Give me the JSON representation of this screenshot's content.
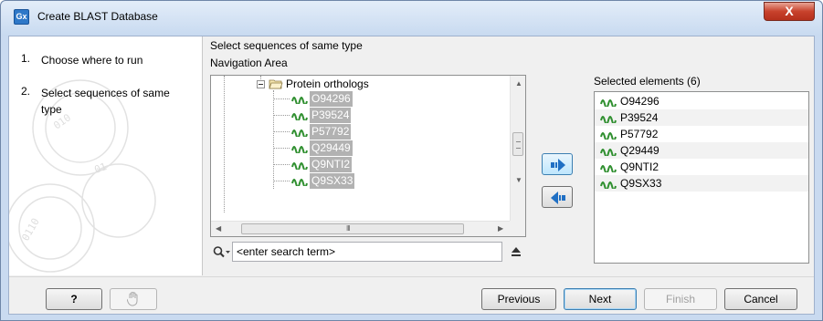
{
  "window": {
    "app_icon": "Gx",
    "title": "Create BLAST Database",
    "close_glyph": "X"
  },
  "steps": [
    {
      "num": "1.",
      "label": "Choose where to run"
    },
    {
      "num": "2.",
      "label": "Select sequences of same type"
    }
  ],
  "content": {
    "heading": "Select sequences of same type",
    "navigation_label": "Navigation Area",
    "selected_label": "Selected elements (6)"
  },
  "tree": {
    "folder": "Protein orthologs",
    "items": [
      "O94296",
      "P39524",
      "P57792",
      "Q29449",
      "Q9NTI2",
      "Q9SX33"
    ],
    "h_thumb_glyph": "III"
  },
  "search": {
    "value": "<enter search term>"
  },
  "selected": {
    "items": [
      "O94296",
      "P39524",
      "P57792",
      "Q29449",
      "Q9NTI2",
      "Q9SX33"
    ]
  },
  "footer": {
    "help_label": "?",
    "previous_label": "Previous",
    "next_label": "Next",
    "finish_label": "Finish",
    "cancel_label": "Cancel"
  },
  "colors": {
    "selection_gray": "#b2b2b2",
    "sequence_icon_green": "#2f8f2f",
    "title_bar_blue": "#c8daf0"
  }
}
